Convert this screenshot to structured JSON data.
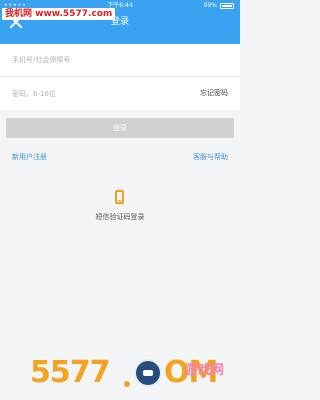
{
  "status_bar": {
    "carrier_dots": "•••••",
    "time": "下午6:44",
    "battery_text": "99%"
  },
  "watermark_top": "我机网 www.5577.com",
  "header": {
    "title": "登录"
  },
  "form": {
    "account_placeholder": "手机号/社会保障号",
    "password_placeholder": "密码，6-16位",
    "forgot_password": "忘记密码"
  },
  "login_button": "登录",
  "links": {
    "register": "新用户注册",
    "help": "客服与帮助"
  },
  "sms_login": {
    "label": "短信验证码登录",
    "icon": "mobile-phone-icon"
  },
  "watermark_bottom": {
    "text_left": "5577",
    "text_right": "OM",
    "tag": "游戏网"
  },
  "colors": {
    "header": "#39a2f1",
    "link": "#3a93d8",
    "button_disabled": "#cfd1d4",
    "phone_icon": "#f2a01f",
    "watermark": "#f4a321"
  }
}
